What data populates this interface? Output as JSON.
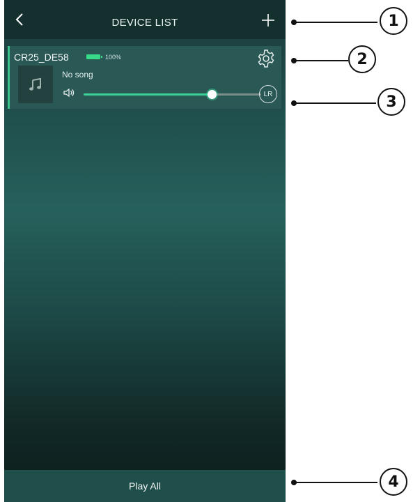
{
  "header": {
    "title": "DEVICE LIST",
    "back_icon": "chevron-left-icon",
    "add_icon": "plus-icon"
  },
  "device": {
    "name": "CR25_DE58",
    "battery_percent": "100%",
    "song": "No song",
    "volume_level": 0.72,
    "channel": "LR"
  },
  "footer": {
    "play_all_label": "Play All"
  },
  "callouts": [
    "1",
    "2",
    "3",
    "4"
  ],
  "colors": {
    "accent": "#3ad49b",
    "header_bg": "#13302f",
    "card_bg": "#2a5855"
  }
}
